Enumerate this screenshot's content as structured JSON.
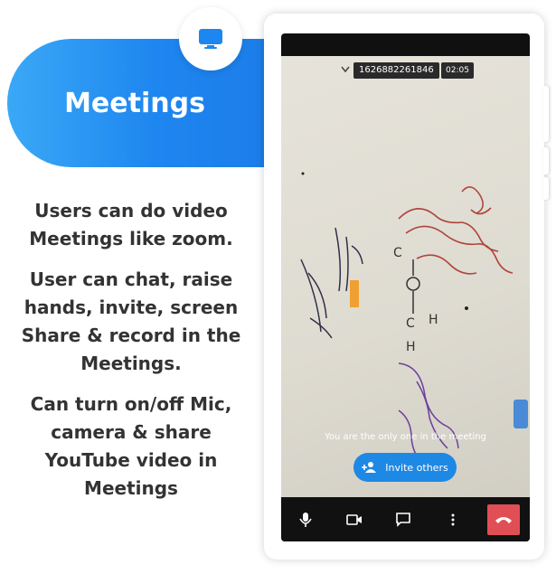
{
  "banner": {
    "title": "Meetings",
    "icon": "monitor-icon"
  },
  "features": [
    "Users can do video Meetings like zoom.",
    "User can chat, raise hands, invite, screen Share & record in the Meetings.",
    "Can turn on/off Mic, camera & share YouTube video in Meetings"
  ],
  "phone": {
    "meeting_id": "1626882261846",
    "timer": "02:05",
    "status_text": "You are the only one in the meeting",
    "invite_label": "Invite others",
    "controls": [
      "mic-icon",
      "camera-icon",
      "chat-icon",
      "more-icon",
      "end-call-icon"
    ]
  },
  "colors": {
    "brand_blue": "#1e86f0",
    "end_call": "#e04f55",
    "invite_button": "#1e88e5"
  }
}
